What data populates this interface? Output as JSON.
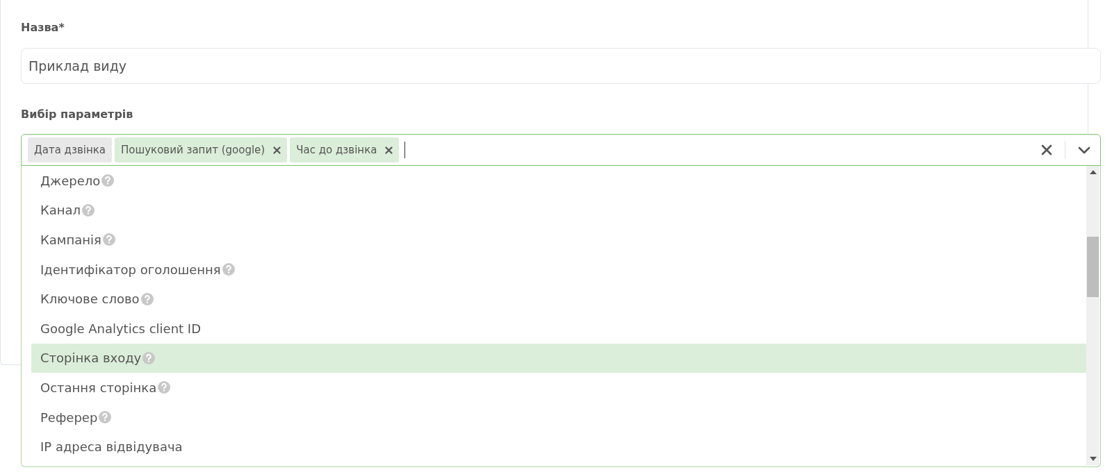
{
  "name_field": {
    "label": "Назва*",
    "value": "Приклад виду"
  },
  "params_field": {
    "label": "Вибір параметрів",
    "chips": [
      {
        "label": "Дата дзвінка",
        "removable": false
      },
      {
        "label": "Пошуковий запит (google)",
        "removable": true
      },
      {
        "label": "Час до дзвінка",
        "removable": true
      }
    ],
    "options": [
      {
        "label": "Джерело",
        "help": true,
        "selected": false
      },
      {
        "label": "Канал",
        "help": true,
        "selected": false
      },
      {
        "label": "Кампанія",
        "help": true,
        "selected": false
      },
      {
        "label": "Ідентифікатор оголошення",
        "help": true,
        "selected": false
      },
      {
        "label": "Ключове слово",
        "help": true,
        "selected": false
      },
      {
        "label": "Google Analytics client ID",
        "help": false,
        "selected": false
      },
      {
        "label": "Сторінка входу",
        "help": true,
        "selected": true
      },
      {
        "label": "Остання сторінка",
        "help": true,
        "selected": false
      },
      {
        "label": "Реферер",
        "help": true,
        "selected": false
      },
      {
        "label": "IP адреса відвідувача",
        "help": false,
        "selected": false
      }
    ]
  }
}
